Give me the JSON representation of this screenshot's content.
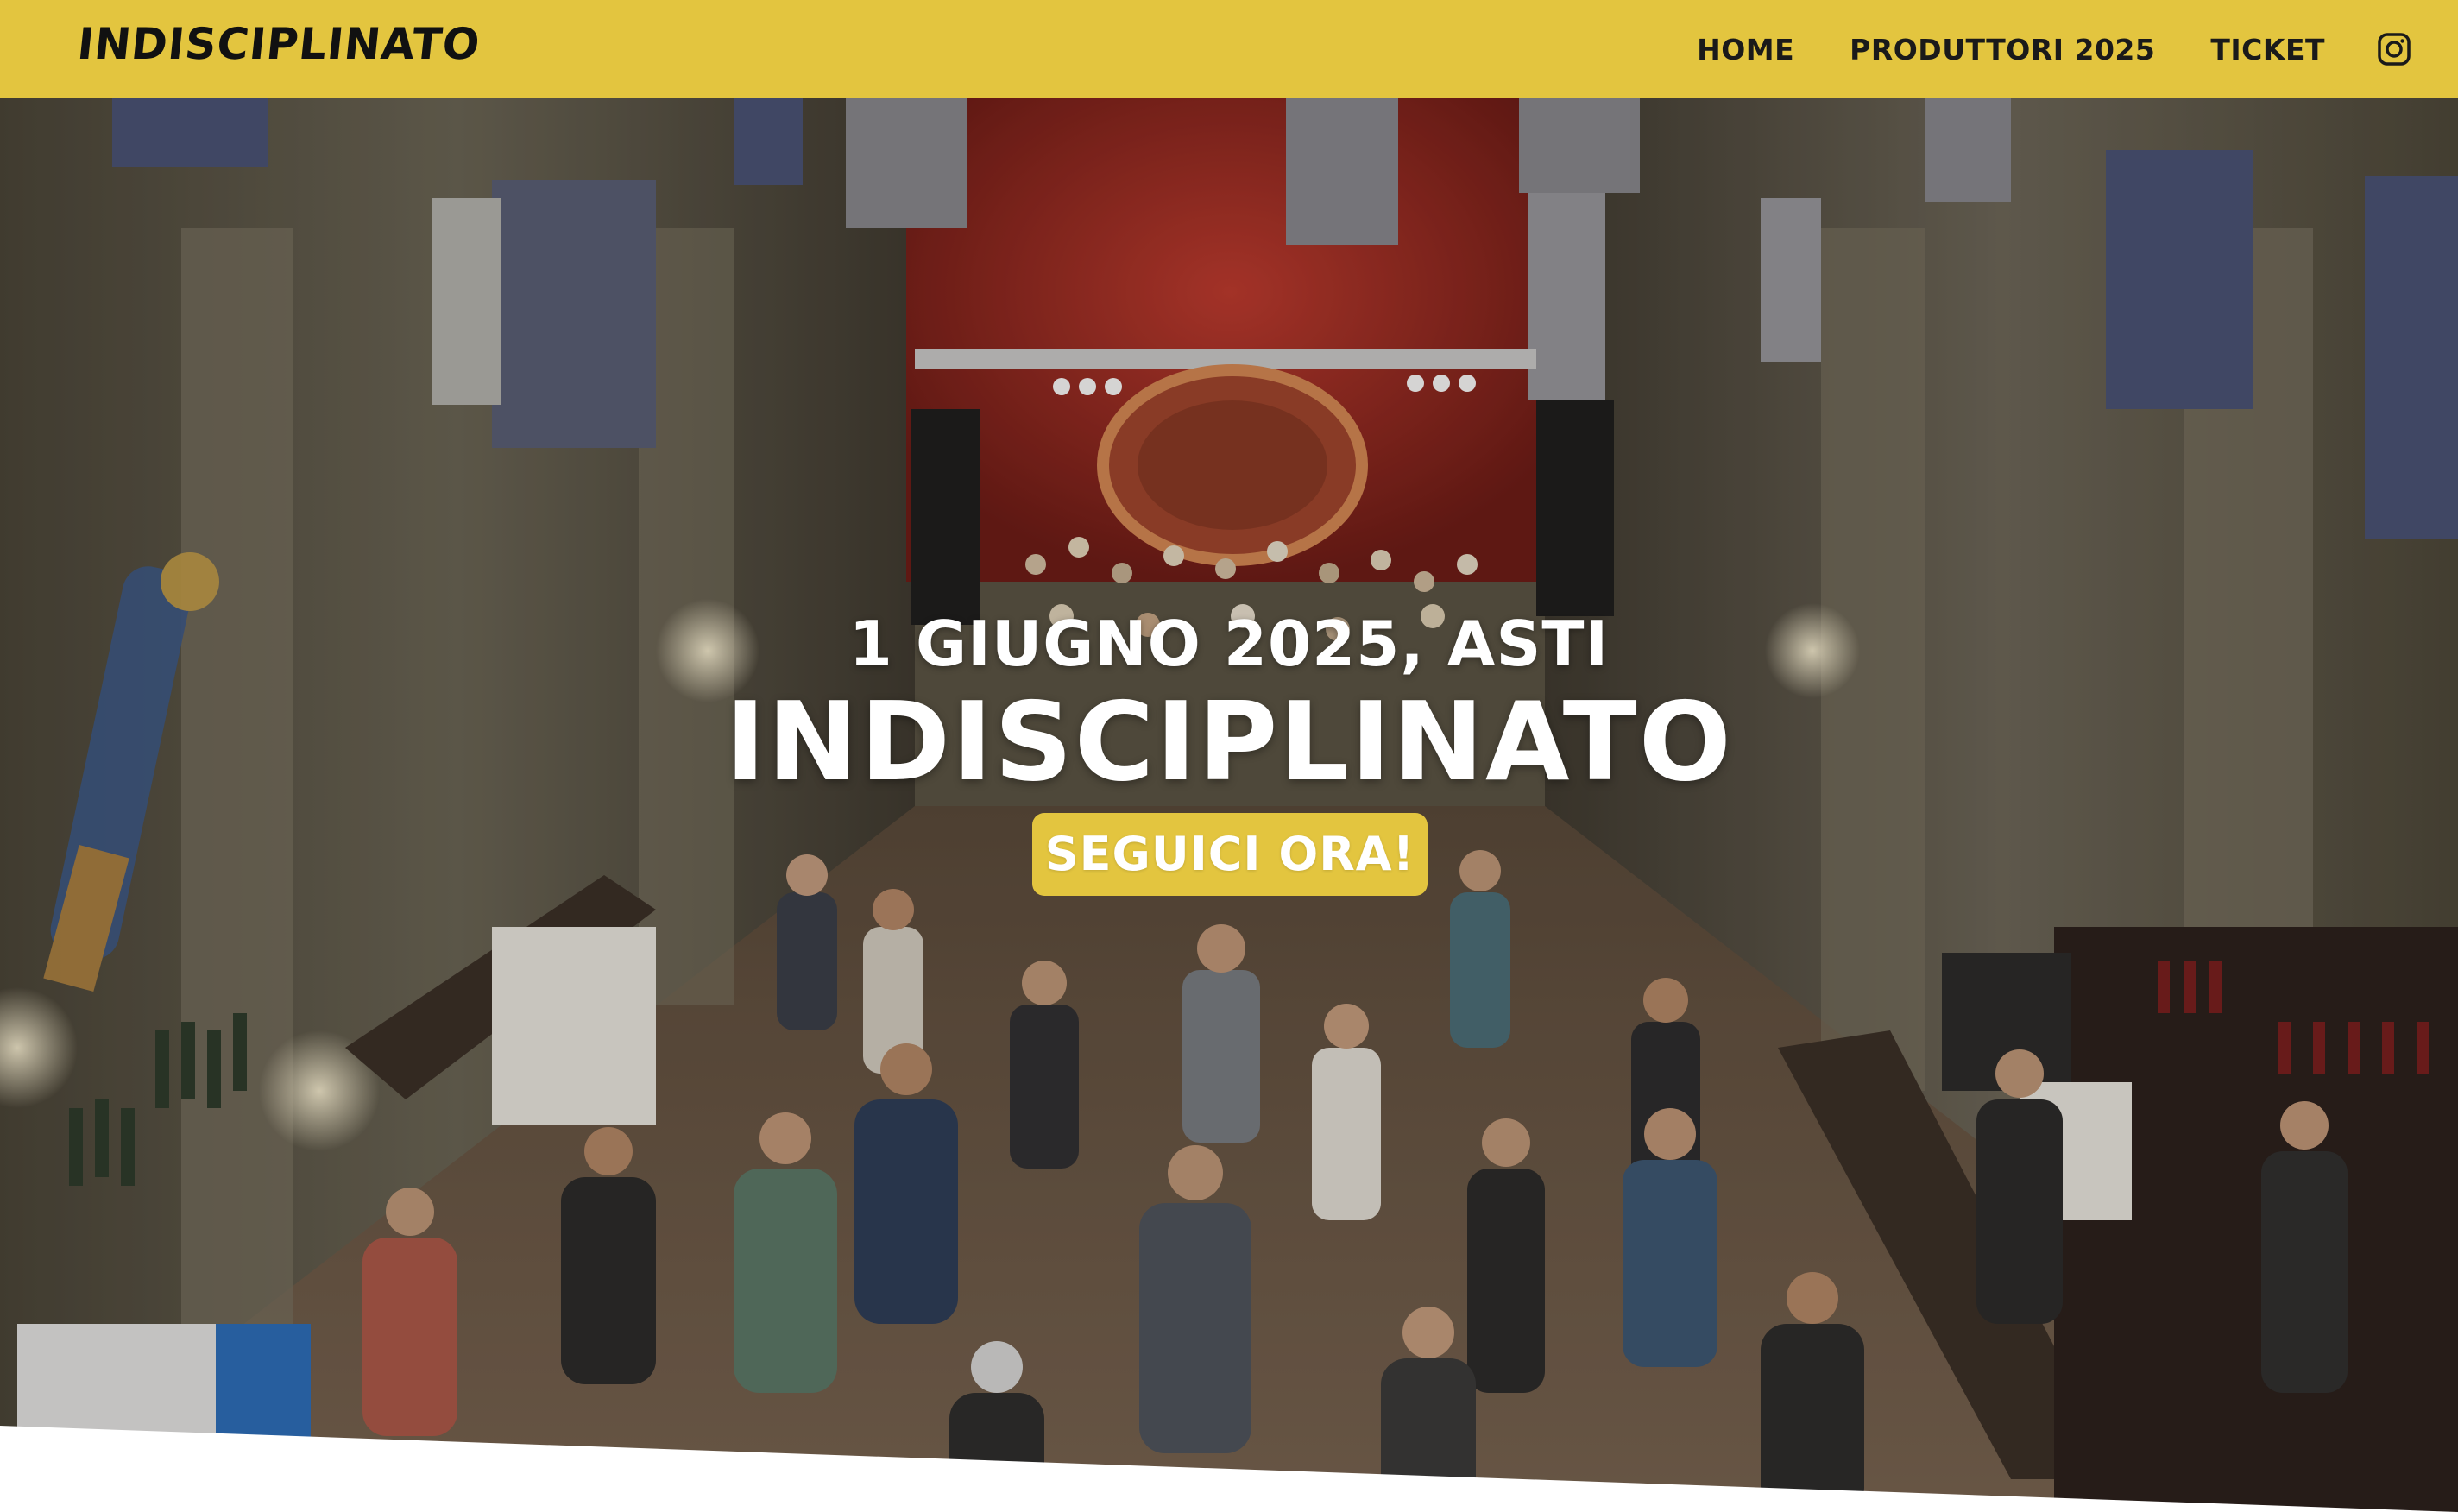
{
  "header": {
    "logo_text": "INDISCIPLINATO",
    "nav": [
      {
        "label": "HOME"
      },
      {
        "label": "PRODUTTORI 2025"
      },
      {
        "label": "TICKET"
      }
    ],
    "social_icon": "instagram-icon"
  },
  "hero": {
    "date_location": "1 GIUGNO 2025, ASTI",
    "title": "INDISCIPLINATO",
    "cta_label": "SEGUICI ORA!"
  },
  "colors": {
    "brand_yellow": "#e3c53f",
    "text_dark": "#1a1a1a",
    "hero_text": "#ffffff"
  }
}
